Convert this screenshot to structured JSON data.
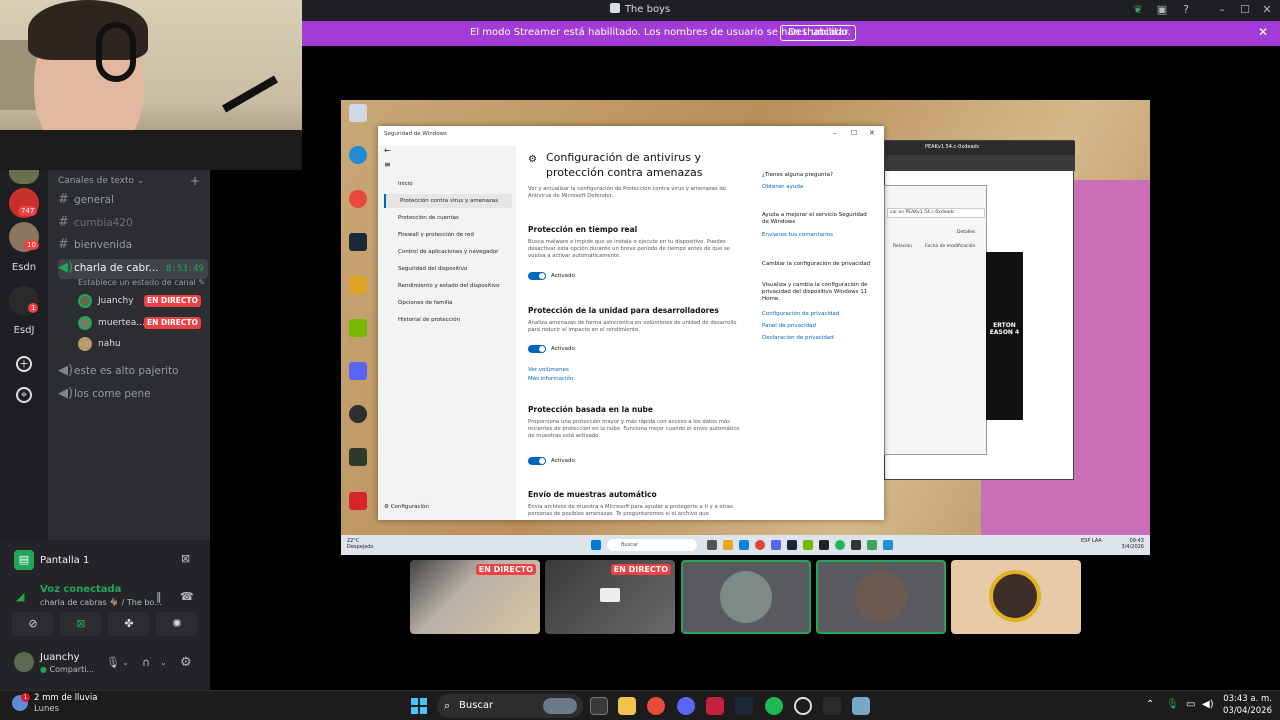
{
  "window": {
    "title": "The boys"
  },
  "banner": {
    "message": "El modo Streamer está habilitado. Los nombres de usuario se han truncado.",
    "button": "Deshabilitar"
  },
  "rail": {
    "badge_747": "747",
    "badge_10": "10",
    "badge_1": "1",
    "server_esdn": "Esdn",
    "server_esdj": "EsdJ"
  },
  "channels": {
    "category": "Canales de texto",
    "items": [
      "general",
      "cumbia420",
      "bienvenida"
    ],
    "voice": {
      "name": "charla de cabr...",
      "timer": "8:53:49",
      "status": "Establece un estado de canal",
      "users": [
        {
          "name": "Juanchy",
          "live": "EN DIRECTO"
        },
        {
          "name": "muertea...",
          "live": "EN DIRECTO"
        },
        {
          "name": "nahu"
        }
      ]
    },
    "voice_extra": [
      "este es alto pajerito",
      "los come pene"
    ]
  },
  "panel": {
    "screen": "Pantalla 1",
    "voice_connected": "Voz conectada",
    "voice_channel": "charla de cabras 🐐 / The bo...",
    "user_name": "Juanchy",
    "user_status": "Comparti..."
  },
  "winsec": {
    "title": "Seguridad de Windows",
    "nav": [
      "Inicio",
      "Protección contra virus y amenazas",
      "Protección de cuentas",
      "Firewall y protección de red",
      "Control de aplicaciones y navegador",
      "Seguridad del dispositivo",
      "Rendimiento y estado del dispositivo",
      "Opciones de familia",
      "Historial de protección"
    ],
    "config": "Configuración",
    "heading": "Configuración de antivirus y protección contra amenazas",
    "intro": "Ver y actualizar la configuración de Protección contra virus y amenazas de Antivirus de Microsoft Defender.",
    "s1_title": "Protección en tiempo real",
    "s1_desc": "Busca malware e impide que se instale o ejecute en tu dispositivo. Puedes desactivar esta opción durante un breve período de tiempo antes de que se vuelva a activar automáticamente.",
    "s2_title": "Protección de la unidad para desarrolladores",
    "s2_desc": "Analiza amenazas de forma asincrónica en volúmenes de unidad de desarrollo para reducir el impacto en el rendimiento.",
    "s2_link1": "Ver volúmenes",
    "s2_link2": "Más información",
    "s3_title": "Protección basada en la nube",
    "s3_desc": "Proporciona una protección mayor y más rápida con acceso a los datos más recientes de protección en la nube. Funciona mejor cuando el envío automático de muestras está activado.",
    "s4_title": "Envío de muestras automático",
    "s4_desc": "Envía archivos de muestra a Microsoft para ayudar a protegerte a ti y a otras personas de posibles amenazas. Te preguntaremos si el archivo que",
    "toggle_label": "Activado",
    "side_q1": "¿Tienes alguna pregunta?",
    "side_l1": "Obtener ayuda",
    "side_q2": "Ayuda a mejorar el servicio Seguridad de Windows",
    "side_l2": "Envíanos tus comentarios",
    "side_q3": "Cambiar la configuración de privacidad",
    "side_q4": "Visualiza y cambia la configuración de privacidad del dispositivo Windows 11 Home.",
    "side_l3": "Configuración de privacidad",
    "side_l4": "Panel de privacidad",
    "side_l5": "Declaración de privacidad"
  },
  "browser": {
    "tab": "PEAKv1.54.c-0xdeadc",
    "search": "car en PEAKv1.54.c-0xdeadc",
    "details": "Detalles",
    "col1": "Relación",
    "col2": "Fecha de modificación",
    "poster": "ERTON EASON 4"
  },
  "inner_taskbar": {
    "weather_temp": "22°C",
    "weather_desc": "Despejado",
    "search": "Buscar",
    "lang": "ESP LAA",
    "time": "09:43",
    "date": "3/4/2026"
  },
  "thumbs": [
    {
      "live": "EN DIRECTO"
    },
    {
      "live": "EN DIRECTO"
    }
  ],
  "taskbar": {
    "weather_title": "2 mm de lluvia",
    "weather_day": "Lunes",
    "weather_badge": "1",
    "search": "Buscar",
    "time": "03:43 a. m.",
    "date": "03/04/2026"
  }
}
